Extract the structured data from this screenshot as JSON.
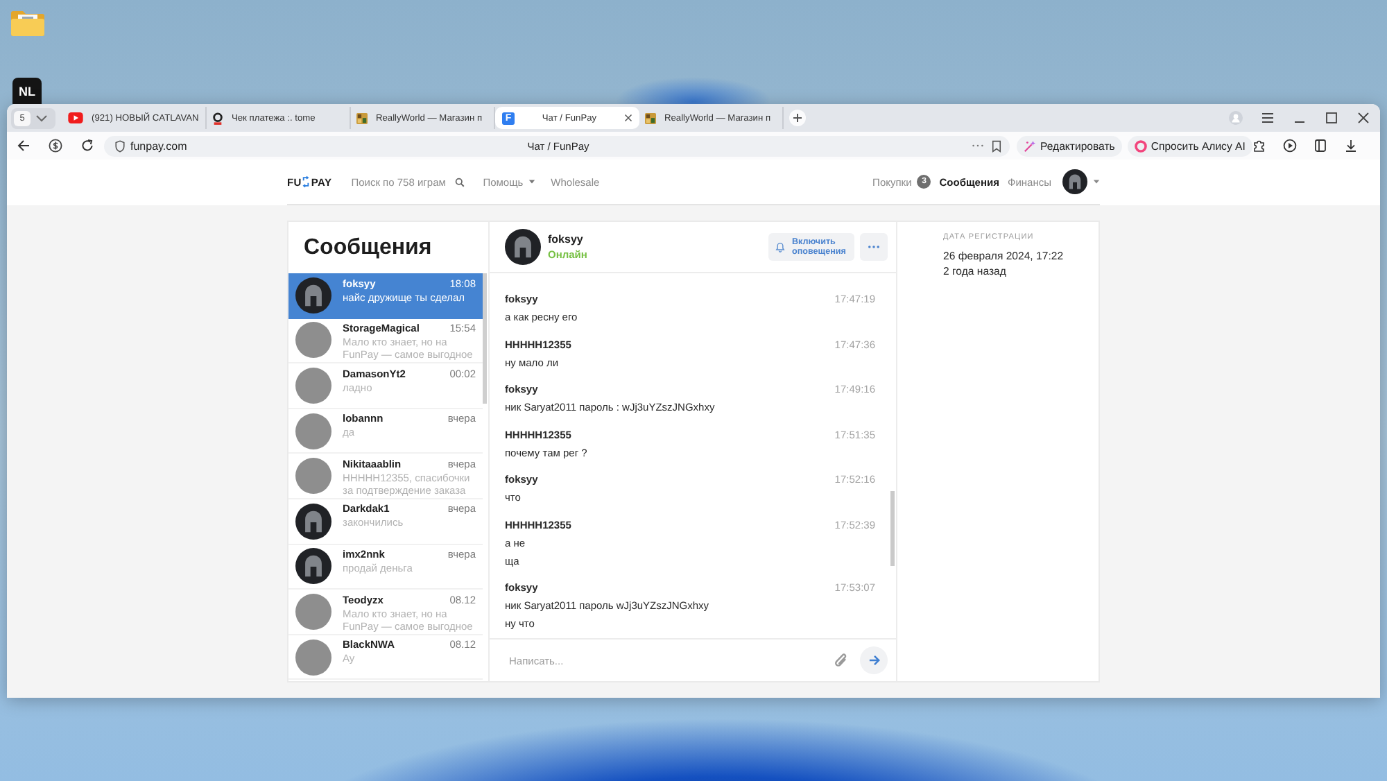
{
  "desktop": {
    "app_tile": "NL"
  },
  "browser": {
    "tab_count": "5",
    "tabs": [
      {
        "kind": "video",
        "title": "(921) НОВЫЙ CATLAVAN",
        "selected": false
      },
      {
        "kind": "receipt",
        "title": "Чек платежа :. tome",
        "selected": false
      },
      {
        "kind": "shop",
        "title": "ReallyWorld — Магазин п",
        "selected": false
      },
      {
        "kind": "site",
        "icon_text": "F",
        "title": "Чат / FunPay",
        "selected": true
      },
      {
        "kind": "shop",
        "title": "ReallyWorld — Магазин п",
        "selected": false
      }
    ],
    "address": {
      "url": "funpay.com",
      "page_title": "Чат / FunPay"
    },
    "actions": [
      {
        "kind": "edit",
        "label": "Редактировать"
      },
      {
        "kind": "assistant",
        "label": "Спросить Алису AI"
      }
    ]
  },
  "site": {
    "logo": {
      "left": "FU",
      "right": "PAY"
    },
    "search": {
      "placeholder": "Поиск по 758 играм"
    },
    "menu": [
      {
        "label": "Помощь",
        "dropdown": true
      },
      {
        "label": "Wholesale",
        "dropdown": false
      }
    ],
    "user_nav": [
      {
        "label": "Покупки",
        "badge": "3",
        "selected": false
      },
      {
        "label": "Сообщения",
        "selected": true
      },
      {
        "label": "Финансы",
        "selected": false
      }
    ]
  },
  "chats": {
    "title": "Сообщения",
    "items": [
      {
        "kind": "helmet",
        "name": "foksyy",
        "time": "18:08",
        "preview": "найс дружище ты сделал",
        "selected": true
      },
      {
        "kind": "photo",
        "name": "StorageMagical",
        "time": "15:54",
        "preview": "Мало кто знает, но на FunPay — самое выгодное",
        "selected": false
      },
      {
        "kind": "photo",
        "name": "DamasonYt2",
        "time": "00:02",
        "preview": "ладно",
        "selected": false
      },
      {
        "kind": "photo",
        "name": "lobannn",
        "time": "вчера",
        "preview": "да",
        "selected": false
      },
      {
        "kind": "photo",
        "name": "Nikitaaablin",
        "time": "вчера",
        "preview": "HHHHH12355, спасибочки за подтверждение заказа",
        "selected": false
      },
      {
        "kind": "helmet",
        "name": "Darkdak1",
        "time": "вчера",
        "preview": "закончились",
        "selected": false
      },
      {
        "kind": "helmet",
        "name": "imx2nnk",
        "time": "вчера",
        "preview": "продай деньга",
        "selected": false
      },
      {
        "kind": "photo",
        "name": "Teodyzx",
        "time": "08.12",
        "preview": "Мало кто знает, но на FunPay — самое выгодное",
        "selected": false
      },
      {
        "kind": "photo",
        "name": "BlackNWA",
        "time": "08.12",
        "preview": "Ау",
        "selected": false
      }
    ]
  },
  "chat": {
    "user": "foksyy",
    "status": "Онлайн",
    "notify_button": "Включить оповещения",
    "messages": [
      {
        "author": "foksyy",
        "time": "17:47:19",
        "lines": [
          "а как ресну его"
        ]
      },
      {
        "author": "HHHHH12355",
        "time": "17:47:36",
        "lines": [
          "ну мало ли"
        ]
      },
      {
        "author": "foksyy",
        "time": "17:49:16",
        "lines": [
          "ник Saryat2011 пароль : wJj3uYZszJNGxhxy"
        ]
      },
      {
        "author": "HHHHH12355",
        "time": "17:51:35",
        "lines": [
          "почему там рег ?"
        ]
      },
      {
        "author": "foksyy",
        "time": "17:52:16",
        "lines": [
          "что"
        ]
      },
      {
        "author": "HHHHH12355",
        "time": "17:52:39",
        "lines": [
          "а не",
          "ща"
        ]
      },
      {
        "author": "foksyy",
        "time": "17:53:07",
        "lines": [
          "ник Saryat2011 пароль wJj3uYZszJNGxhxy",
          "ну что"
        ]
      }
    ],
    "input": {
      "placeholder": "Написать..."
    }
  },
  "profile": {
    "label": "ДАТА РЕГИСТРАЦИИ",
    "date": "26 февраля 2024, 17:22",
    "ago": "2 года назад"
  }
}
